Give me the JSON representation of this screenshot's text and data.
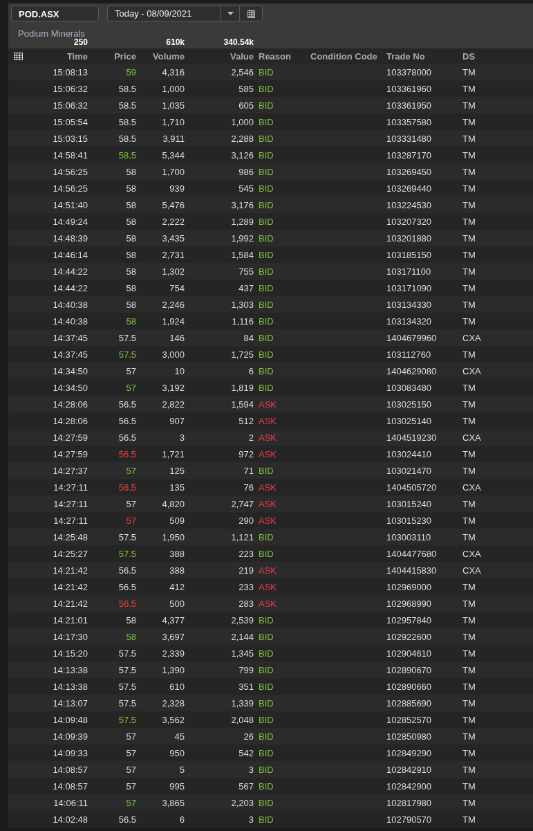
{
  "symbol_field": {
    "value": "POD.ASX"
  },
  "date_picker": {
    "value": "Today - 08/09/2021"
  },
  "company_name": "Podium Minerals",
  "summary": {
    "trades": "250",
    "volume": "610k",
    "value": "340.54k"
  },
  "columns": [
    "Time",
    "Price",
    "Volume",
    "Value",
    "Reason",
    "Condition Code",
    "Trade No",
    "DS"
  ],
  "rows": [
    {
      "time": "15:08:13",
      "price": "59",
      "tick_up": true,
      "tick_down": false,
      "volume": "4,316",
      "value": "2,546",
      "reason": "BID",
      "ask": false,
      "trade_no": "103378000",
      "ds": "TM"
    },
    {
      "time": "15:06:32",
      "price": "58.5",
      "tick_up": false,
      "tick_down": false,
      "volume": "1,000",
      "value": "585",
      "reason": "BID",
      "ask": false,
      "trade_no": "103361960",
      "ds": "TM"
    },
    {
      "time": "15:06:32",
      "price": "58.5",
      "tick_up": false,
      "tick_down": false,
      "volume": "1,035",
      "value": "605",
      "reason": "BID",
      "ask": false,
      "trade_no": "103361950",
      "ds": "TM"
    },
    {
      "time": "15:05:54",
      "price": "58.5",
      "tick_up": false,
      "tick_down": false,
      "volume": "1,710",
      "value": "1,000",
      "reason": "BID",
      "ask": false,
      "trade_no": "103357580",
      "ds": "TM"
    },
    {
      "time": "15:03:15",
      "price": "58.5",
      "tick_up": false,
      "tick_down": false,
      "volume": "3,911",
      "value": "2,288",
      "reason": "BID",
      "ask": false,
      "trade_no": "103331480",
      "ds": "TM"
    },
    {
      "time": "14:58:41",
      "price": "58.5",
      "tick_up": true,
      "tick_down": false,
      "volume": "5,344",
      "value": "3,126",
      "reason": "BID",
      "ask": false,
      "trade_no": "103287170",
      "ds": "TM"
    },
    {
      "time": "14:56:25",
      "price": "58",
      "tick_up": false,
      "tick_down": false,
      "volume": "1,700",
      "value": "986",
      "reason": "BID",
      "ask": false,
      "trade_no": "103269450",
      "ds": "TM"
    },
    {
      "time": "14:56:25",
      "price": "58",
      "tick_up": false,
      "tick_down": false,
      "volume": "939",
      "value": "545",
      "reason": "BID",
      "ask": false,
      "trade_no": "103269440",
      "ds": "TM"
    },
    {
      "time": "14:51:40",
      "price": "58",
      "tick_up": false,
      "tick_down": false,
      "volume": "5,476",
      "value": "3,176",
      "reason": "BID",
      "ask": false,
      "trade_no": "103224530",
      "ds": "TM"
    },
    {
      "time": "14:49:24",
      "price": "58",
      "tick_up": false,
      "tick_down": false,
      "volume": "2,222",
      "value": "1,289",
      "reason": "BID",
      "ask": false,
      "trade_no": "103207320",
      "ds": "TM"
    },
    {
      "time": "14:48:39",
      "price": "58",
      "tick_up": false,
      "tick_down": false,
      "volume": "3,435",
      "value": "1,992",
      "reason": "BID",
      "ask": false,
      "trade_no": "103201880",
      "ds": "TM"
    },
    {
      "time": "14:46:14",
      "price": "58",
      "tick_up": false,
      "tick_down": false,
      "volume": "2,731",
      "value": "1,584",
      "reason": "BID",
      "ask": false,
      "trade_no": "103185150",
      "ds": "TM"
    },
    {
      "time": "14:44:22",
      "price": "58",
      "tick_up": false,
      "tick_down": false,
      "volume": "1,302",
      "value": "755",
      "reason": "BID",
      "ask": false,
      "trade_no": "103171100",
      "ds": "TM"
    },
    {
      "time": "14:44:22",
      "price": "58",
      "tick_up": false,
      "tick_down": false,
      "volume": "754",
      "value": "437",
      "reason": "BID",
      "ask": false,
      "trade_no": "103171090",
      "ds": "TM"
    },
    {
      "time": "14:40:38",
      "price": "58",
      "tick_up": false,
      "tick_down": false,
      "volume": "2,246",
      "value": "1,303",
      "reason": "BID",
      "ask": false,
      "trade_no": "103134330",
      "ds": "TM"
    },
    {
      "time": "14:40:38",
      "price": "58",
      "tick_up": true,
      "tick_down": false,
      "volume": "1,924",
      "value": "1,116",
      "reason": "BID",
      "ask": false,
      "trade_no": "103134320",
      "ds": "TM"
    },
    {
      "time": "14:37:45",
      "price": "57.5",
      "tick_up": false,
      "tick_down": false,
      "volume": "146",
      "value": "84",
      "reason": "BID",
      "ask": false,
      "trade_no": "1404679960",
      "ds": "CXA"
    },
    {
      "time": "14:37:45",
      "price": "57.5",
      "tick_up": true,
      "tick_down": false,
      "volume": "3,000",
      "value": "1,725",
      "reason": "BID",
      "ask": false,
      "trade_no": "103112760",
      "ds": "TM"
    },
    {
      "time": "14:34:50",
      "price": "57",
      "tick_up": false,
      "tick_down": false,
      "volume": "10",
      "value": "6",
      "reason": "BID",
      "ask": false,
      "trade_no": "1404629080",
      "ds": "CXA"
    },
    {
      "time": "14:34:50",
      "price": "57",
      "tick_up": true,
      "tick_down": false,
      "volume": "3,192",
      "value": "1,819",
      "reason": "BID",
      "ask": false,
      "trade_no": "103083480",
      "ds": "TM"
    },
    {
      "time": "14:28:06",
      "price": "56.5",
      "tick_up": false,
      "tick_down": false,
      "volume": "2,822",
      "value": "1,594",
      "reason": "ASK",
      "ask": true,
      "trade_no": "103025150",
      "ds": "TM"
    },
    {
      "time": "14:28:06",
      "price": "56.5",
      "tick_up": false,
      "tick_down": false,
      "volume": "907",
      "value": "512",
      "reason": "ASK",
      "ask": true,
      "trade_no": "103025140",
      "ds": "TM"
    },
    {
      "time": "14:27:59",
      "price": "56.5",
      "tick_up": false,
      "tick_down": false,
      "volume": "3",
      "value": "2",
      "reason": "ASK",
      "ask": true,
      "trade_no": "1404519230",
      "ds": "CXA"
    },
    {
      "time": "14:27:59",
      "price": "56.5",
      "tick_up": false,
      "tick_down": true,
      "volume": "1,721",
      "value": "972",
      "reason": "ASK",
      "ask": true,
      "trade_no": "103024410",
      "ds": "TM"
    },
    {
      "time": "14:27:37",
      "price": "57",
      "tick_up": true,
      "tick_down": false,
      "volume": "125",
      "value": "71",
      "reason": "BID",
      "ask": false,
      "trade_no": "103021470",
      "ds": "TM"
    },
    {
      "time": "14:27:11",
      "price": "56.5",
      "tick_up": false,
      "tick_down": true,
      "volume": "135",
      "value": "76",
      "reason": "ASK",
      "ask": true,
      "trade_no": "1404505720",
      "ds": "CXA"
    },
    {
      "time": "14:27:11",
      "price": "57",
      "tick_up": false,
      "tick_down": false,
      "volume": "4,820",
      "value": "2,747",
      "reason": "ASK",
      "ask": true,
      "trade_no": "103015240",
      "ds": "TM"
    },
    {
      "time": "14:27:11",
      "price": "57",
      "tick_up": false,
      "tick_down": true,
      "volume": "509",
      "value": "290",
      "reason": "ASK",
      "ask": true,
      "trade_no": "103015230",
      "ds": "TM"
    },
    {
      "time": "14:25:48",
      "price": "57.5",
      "tick_up": false,
      "tick_down": false,
      "volume": "1,950",
      "value": "1,121",
      "reason": "BID",
      "ask": false,
      "trade_no": "103003110",
      "ds": "TM"
    },
    {
      "time": "14:25:27",
      "price": "57.5",
      "tick_up": true,
      "tick_down": false,
      "volume": "388",
      "value": "223",
      "reason": "BID",
      "ask": false,
      "trade_no": "1404477680",
      "ds": "CXA"
    },
    {
      "time": "14:21:42",
      "price": "56.5",
      "tick_up": false,
      "tick_down": false,
      "volume": "388",
      "value": "219",
      "reason": "ASK",
      "ask": true,
      "trade_no": "1404415830",
      "ds": "CXA"
    },
    {
      "time": "14:21:42",
      "price": "56.5",
      "tick_up": false,
      "tick_down": false,
      "volume": "412",
      "value": "233",
      "reason": "ASK",
      "ask": true,
      "trade_no": "102969000",
      "ds": "TM"
    },
    {
      "time": "14:21:42",
      "price": "56.5",
      "tick_up": false,
      "tick_down": true,
      "volume": "500",
      "value": "283",
      "reason": "ASK",
      "ask": true,
      "trade_no": "102968990",
      "ds": "TM"
    },
    {
      "time": "14:21:01",
      "price": "58",
      "tick_up": false,
      "tick_down": false,
      "volume": "4,377",
      "value": "2,539",
      "reason": "BID",
      "ask": false,
      "trade_no": "102957840",
      "ds": "TM"
    },
    {
      "time": "14:17:30",
      "price": "58",
      "tick_up": true,
      "tick_down": false,
      "volume": "3,697",
      "value": "2,144",
      "reason": "BID",
      "ask": false,
      "trade_no": "102922600",
      "ds": "TM"
    },
    {
      "time": "14:15:20",
      "price": "57.5",
      "tick_up": false,
      "tick_down": false,
      "volume": "2,339",
      "value": "1,345",
      "reason": "BID",
      "ask": false,
      "trade_no": "102904610",
      "ds": "TM"
    },
    {
      "time": "14:13:38",
      "price": "57.5",
      "tick_up": false,
      "tick_down": false,
      "volume": "1,390",
      "value": "799",
      "reason": "BID",
      "ask": false,
      "trade_no": "102890670",
      "ds": "TM"
    },
    {
      "time": "14:13:38",
      "price": "57.5",
      "tick_up": false,
      "tick_down": false,
      "volume": "610",
      "value": "351",
      "reason": "BID",
      "ask": false,
      "trade_no": "102890660",
      "ds": "TM"
    },
    {
      "time": "14:13:07",
      "price": "57.5",
      "tick_up": false,
      "tick_down": false,
      "volume": "2,328",
      "value": "1,339",
      "reason": "BID",
      "ask": false,
      "trade_no": "102885690",
      "ds": "TM"
    },
    {
      "time": "14:09:48",
      "price": "57.5",
      "tick_up": true,
      "tick_down": false,
      "volume": "3,562",
      "value": "2,048",
      "reason": "BID",
      "ask": false,
      "trade_no": "102852570",
      "ds": "TM"
    },
    {
      "time": "14:09:39",
      "price": "57",
      "tick_up": false,
      "tick_down": false,
      "volume": "45",
      "value": "26",
      "reason": "BID",
      "ask": false,
      "trade_no": "102850980",
      "ds": "TM"
    },
    {
      "time": "14:09:33",
      "price": "57",
      "tick_up": false,
      "tick_down": false,
      "volume": "950",
      "value": "542",
      "reason": "BID",
      "ask": false,
      "trade_no": "102849290",
      "ds": "TM"
    },
    {
      "time": "14:08:57",
      "price": "57",
      "tick_up": false,
      "tick_down": false,
      "volume": "5",
      "value": "3",
      "reason": "BID",
      "ask": false,
      "trade_no": "102842910",
      "ds": "TM"
    },
    {
      "time": "14:08:57",
      "price": "57",
      "tick_up": false,
      "tick_down": false,
      "volume": "995",
      "value": "567",
      "reason": "BID",
      "ask": false,
      "trade_no": "102842900",
      "ds": "TM"
    },
    {
      "time": "14:06:11",
      "price": "57",
      "tick_up": true,
      "tick_down": false,
      "volume": "3,865",
      "value": "2,203",
      "reason": "BID",
      "ask": false,
      "trade_no": "102817980",
      "ds": "TM"
    },
    {
      "time": "14:02:48",
      "price": "56.5",
      "tick_up": false,
      "tick_down": false,
      "volume": "6",
      "value": "3",
      "reason": "BID",
      "ask": false,
      "trade_no": "102790570",
      "ds": "TM"
    }
  ]
}
